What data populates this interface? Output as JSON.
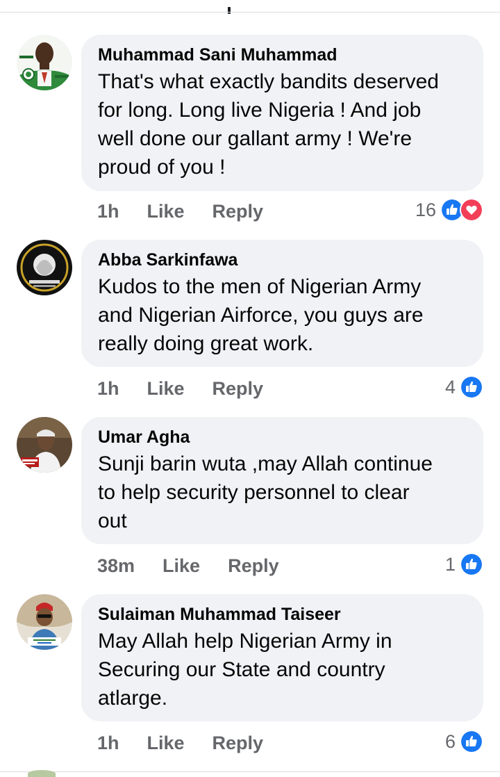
{
  "comments": [
    {
      "author": "Muhammad Sani Muhammad",
      "lines": [
        "That's what exactly bandits deserved",
        "for long. Long live Nigeria ! And job",
        "well done our gallant army ! We're",
        "proud of you !"
      ],
      "time": "1h",
      "like_label": "Like",
      "reply_label": "Reply",
      "reaction_count": "16",
      "reactions": [
        "like-icon",
        "love-icon"
      ]
    },
    {
      "author": "Abba Sarkinfawa",
      "lines": [
        "Kudos to the men of Nigerian Army",
        "and Nigerian Airforce, you guys are",
        "really doing great work."
      ],
      "time": "1h",
      "like_label": "Like",
      "reply_label": "Reply",
      "reaction_count": "4",
      "reactions": [
        "like-icon"
      ]
    },
    {
      "author": "Umar Agha",
      "lines": [
        "Sunji barin wuta ,may Allah continue",
        "to help security personnel to clear",
        "out"
      ],
      "time": "38m",
      "like_label": "Like",
      "reply_label": "Reply",
      "reaction_count": "1",
      "reactions": [
        "like-icon"
      ]
    },
    {
      "author": "Sulaiman Muhammad Taiseer",
      "lines": [
        "May Allah help Nigerian Army in",
        "Securing our State and country",
        "atlarge."
      ],
      "time": "1h",
      "like_label": "Like",
      "reply_label": "Reply",
      "reaction_count": "6",
      "reactions": [
        "like-icon"
      ]
    }
  ],
  "colors": {
    "bubble_bg": "#f0f2f5",
    "like_blue": "#1877f2",
    "love_red": "#f33e58",
    "meta_gray": "#65676b"
  }
}
